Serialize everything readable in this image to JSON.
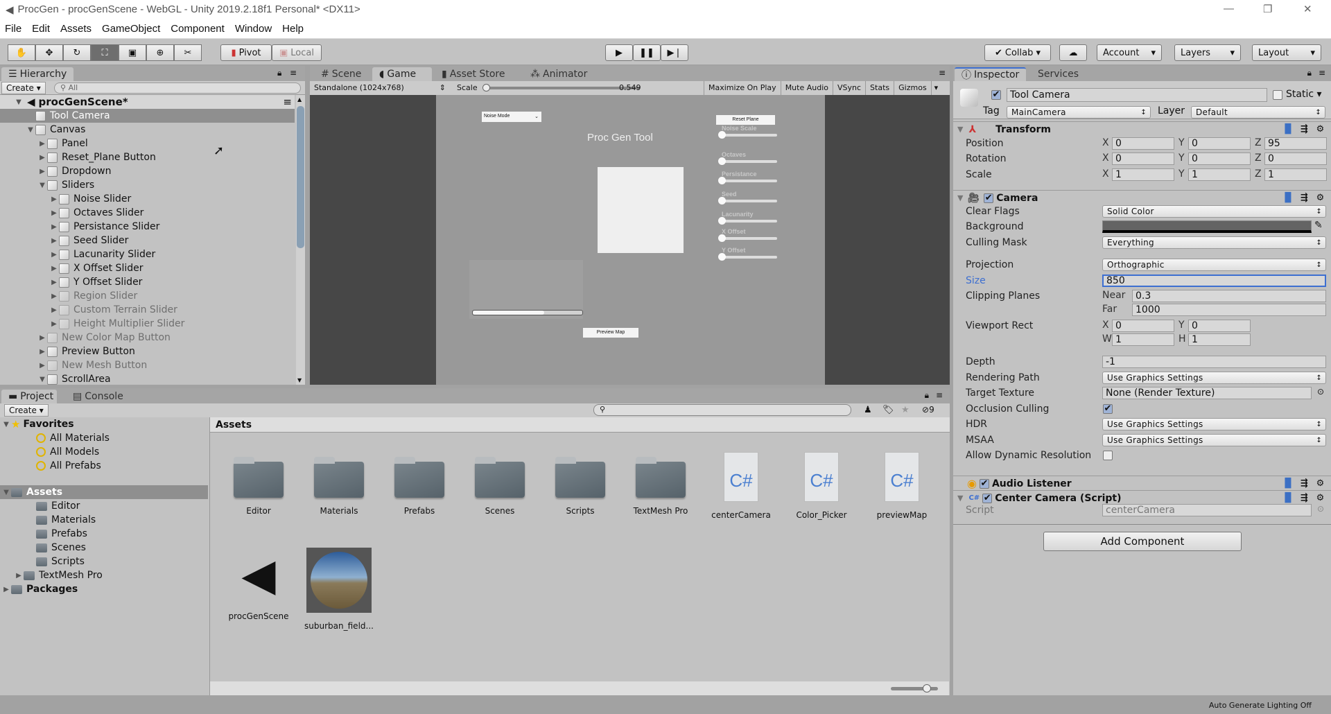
{
  "window": {
    "title": "ProcGen - procGenScene - WebGL - Unity 2019.2.18f1 Personal* <DX11>"
  },
  "menu": [
    "File",
    "Edit",
    "Assets",
    "GameObject",
    "Component",
    "Window",
    "Help"
  ],
  "toolbar": {
    "tools": [
      "hand-tool",
      "move-tool",
      "rotate-tool",
      "scale-tool",
      "rect-tool",
      "transform-tool",
      "custom-tool"
    ],
    "active_tool": "scale-tool",
    "pivot": "Pivot",
    "local": "Local",
    "collab": "Collab",
    "account": "Account",
    "layers": "Layers",
    "layout": "Layout"
  },
  "hierarchy": {
    "tab": "Hierarchy",
    "create": "Create",
    "search_placeholder": "All",
    "scene": "procGenScene*",
    "items": [
      {
        "label": "Tool Camera",
        "depth": 1,
        "arrow": "",
        "state": "selected"
      },
      {
        "label": "Canvas",
        "depth": 1,
        "arrow": "open",
        "state": ""
      },
      {
        "label": "Panel",
        "depth": 2,
        "arrow": "closed",
        "state": ""
      },
      {
        "label": "Reset_Plane Button",
        "depth": 2,
        "arrow": "closed",
        "state": ""
      },
      {
        "label": "Dropdown",
        "depth": 2,
        "arrow": "closed",
        "state": ""
      },
      {
        "label": "Sliders",
        "depth": 2,
        "arrow": "open",
        "state": ""
      },
      {
        "label": "Noise Slider",
        "depth": 3,
        "arrow": "closed",
        "state": ""
      },
      {
        "label": "Octaves Slider",
        "depth": 3,
        "arrow": "closed",
        "state": ""
      },
      {
        "label": "Persistance Slider",
        "depth": 3,
        "arrow": "closed",
        "state": ""
      },
      {
        "label": "Seed Slider",
        "depth": 3,
        "arrow": "closed",
        "state": ""
      },
      {
        "label": "Lacunarity Slider",
        "depth": 3,
        "arrow": "closed",
        "state": ""
      },
      {
        "label": "X Offset Slider",
        "depth": 3,
        "arrow": "closed",
        "state": ""
      },
      {
        "label": "Y Offset Slider",
        "depth": 3,
        "arrow": "closed",
        "state": ""
      },
      {
        "label": "Region Slider",
        "depth": 3,
        "arrow": "closed",
        "state": "inactive"
      },
      {
        "label": "Custom Terrain Slider",
        "depth": 3,
        "arrow": "closed",
        "state": "inactive"
      },
      {
        "label": "Height Multiplier Slider",
        "depth": 3,
        "arrow": "closed",
        "state": "inactive"
      },
      {
        "label": "New Color Map Button",
        "depth": 2,
        "arrow": "closed",
        "state": "inactive"
      },
      {
        "label": "Preview Button",
        "depth": 2,
        "arrow": "closed",
        "state": ""
      },
      {
        "label": "New Mesh Button",
        "depth": 2,
        "arrow": "closed",
        "state": "inactive"
      },
      {
        "label": "ScrollArea",
        "depth": 2,
        "arrow": "open",
        "state": ""
      }
    ]
  },
  "center": {
    "tabs": [
      "Scene",
      "Game",
      "Asset Store",
      "Animator"
    ],
    "active_tab": "Game",
    "resolution": "Standalone (1024x768)",
    "scale_label": "Scale",
    "scale_value": "0.549",
    "buttons": [
      "Maximize On Play",
      "Mute Audio",
      "VSync",
      "Stats",
      "Gizmos"
    ],
    "game": {
      "dropdown": "Noise Mode",
      "title": "Proc Gen Tool",
      "reset": "Reset Plane",
      "preview": "Preview Map",
      "scroll_fill": 0.65,
      "sliders": [
        "Noise Scale",
        "Octaves",
        "Persistance",
        "Seed",
        "Lacunarity",
        "X Offset",
        "Y Offset"
      ]
    }
  },
  "inspector": {
    "tabs": [
      "Inspector",
      "Services"
    ],
    "name": "Tool Camera",
    "static": "Static",
    "tag_label": "Tag",
    "tag": "MainCamera",
    "layer_label": "Layer",
    "layer": "Default",
    "transform": {
      "title": "Transform",
      "position_label": "Position",
      "rotation_label": "Rotation",
      "scale_label": "Scale",
      "position": [
        "0",
        "0",
        "95"
      ],
      "rotation": [
        "0",
        "0",
        "0"
      ],
      "scale": [
        "1",
        "1",
        "1"
      ]
    },
    "camera": {
      "title": "Camera",
      "clear_flags_label": "Clear Flags",
      "clear_flags": "Solid Color",
      "background_label": "Background",
      "background_color": "#646464",
      "culling_label": "Culling Mask",
      "culling": "Everything",
      "projection_label": "Projection",
      "projection": "Orthographic",
      "size_label": "Size",
      "size": "850",
      "clipping_label": "Clipping Planes",
      "near_label": "Near",
      "near": "0.3",
      "far_label": "Far",
      "far": "1000",
      "viewport_label": "Viewport Rect",
      "viewport": {
        "x": "0",
        "y": "0",
        "w": "1",
        "h": "1"
      },
      "depth_label": "Depth",
      "depth": "-1",
      "rendering_label": "Rendering Path",
      "rendering": "Use Graphics Settings",
      "target_label": "Target Texture",
      "target": "None (Render Texture)",
      "occlusion_label": "Occlusion Culling",
      "occlusion": true,
      "hdr_label": "HDR",
      "hdr": "Use Graphics Settings",
      "msaa_label": "MSAA",
      "msaa": "Use Graphics Settings",
      "dynres_label": "Allow Dynamic Resolution",
      "dynres": false
    },
    "audio": "Audio Listener",
    "script_comp": "Center Camera (Script)",
    "script_label": "Script",
    "script": "centerCamera",
    "add_component": "Add Component"
  },
  "project": {
    "tabs": [
      "Project",
      "Console"
    ],
    "create": "Create",
    "hidden_count": "9",
    "favorites": {
      "label": "Favorites",
      "items": [
        "All Materials",
        "All Models",
        "All Prefabs"
      ]
    },
    "assets_label": "Assets",
    "folders": [
      "Editor",
      "Materials",
      "Prefabs",
      "Scenes",
      "Scripts",
      "TextMesh Pro"
    ],
    "packages": "Packages",
    "breadcrumb": "Assets",
    "grid": [
      {
        "name": "Editor",
        "type": "folder"
      },
      {
        "name": "Materials",
        "type": "folder"
      },
      {
        "name": "Prefabs",
        "type": "folder"
      },
      {
        "name": "Scenes",
        "type": "folder"
      },
      {
        "name": "Scripts",
        "type": "folder"
      },
      {
        "name": "TextMesh Pro",
        "type": "folder"
      },
      {
        "name": "centerCamera",
        "type": "script"
      },
      {
        "name": "Color_Picker",
        "type": "script"
      },
      {
        "name": "previewMap",
        "type": "script"
      },
      {
        "name": "procGenScene",
        "type": "scene"
      },
      {
        "name": "suburban_field...",
        "type": "skybox"
      }
    ]
  },
  "status": {
    "text": "Auto Generate Lighting Off"
  },
  "colors": {
    "selection": "#8f8f8f",
    "accent": "#3d6fd1",
    "panel": "#c2c2c2",
    "game_bg": "#999999"
  }
}
